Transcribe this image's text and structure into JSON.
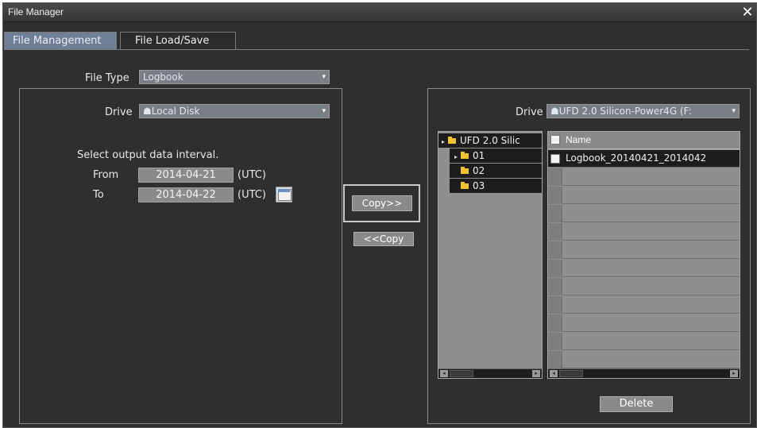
{
  "window": {
    "title": "File Manager",
    "close_symbol": "✕"
  },
  "tabs": [
    {
      "label": "File Management",
      "active": true
    },
    {
      "label": "File Load/Save",
      "active": false
    }
  ],
  "file_type": {
    "label": "File Type",
    "value": "Logbook"
  },
  "left_panel": {
    "drive_label": "Drive",
    "drive_value": "Local Disk",
    "interval_heading": "Select output data interval.",
    "from_label": "From",
    "from_value": "2014-04-21",
    "to_label": "To",
    "to_value": "2014-04-22",
    "utc": "(UTC)"
  },
  "buttons": {
    "copy_right": "Copy>>",
    "copy_left": "<<Copy",
    "delete": "Delete"
  },
  "right_panel": {
    "drive_label": "Drive",
    "drive_value": "UFD 2.0 Silicon-Power4G (F:",
    "tree": [
      {
        "label": "UFD 2.0 Silic",
        "expand": "▸",
        "level": 0
      },
      {
        "label": "01",
        "expand": "▸",
        "level": 1
      },
      {
        "label": "02",
        "expand": "",
        "level": 1
      },
      {
        "label": "03",
        "expand": "",
        "level": 1
      }
    ],
    "list_header": "Name",
    "files": [
      "Logbook_20140421_2014042"
    ]
  },
  "colors": {
    "active_tab": "#6f7f96",
    "folder": "#f2c230",
    "window_bg": "#2f2f2f"
  }
}
